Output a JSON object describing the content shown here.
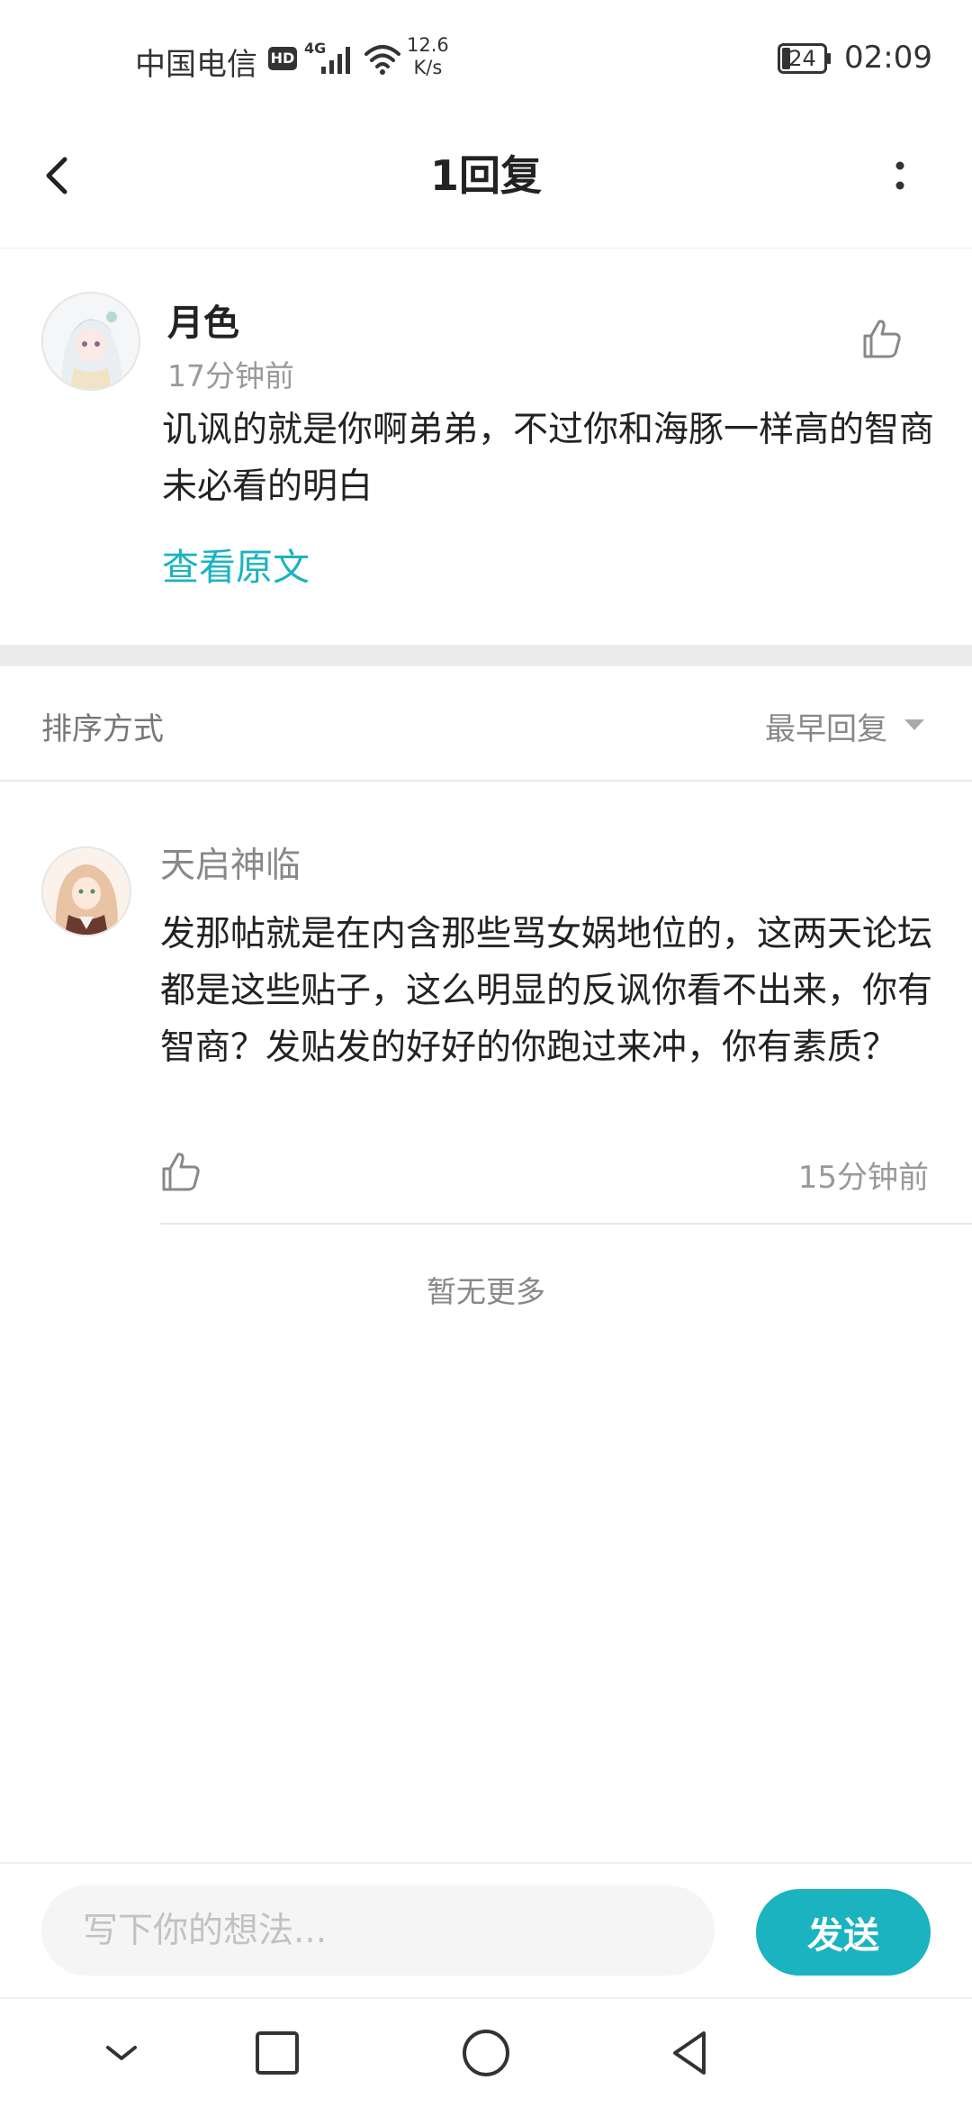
{
  "status_bar": {
    "carrier": "中国电信",
    "hd": "HD",
    "network": "4G",
    "speed_value": "12.6",
    "speed_unit": "K/s",
    "battery": "24",
    "time": "02:09"
  },
  "nav": {
    "title": "1回复"
  },
  "post": {
    "author": "月色",
    "time": "17分钟前",
    "body": "讥讽的就是你啊弟弟，不过你和海豚一样高的智商未必看的明白",
    "view_original": "查看原文"
  },
  "sort": {
    "label": "排序方式",
    "value": "最早回复"
  },
  "reply": {
    "author": "天启神临",
    "body": "发那帖就是在内含那些骂女娲地位的，这两天论坛都是这些贴子，这么明显的反讽你看不出来，你有智商？发贴发的好好的你跑过来冲，你有素质？",
    "time": "15分钟前"
  },
  "no_more": "暂无更多",
  "composer": {
    "placeholder": "写下你的想法...",
    "send_label": "发送"
  },
  "colors": {
    "accent": "#1ab3bf"
  }
}
